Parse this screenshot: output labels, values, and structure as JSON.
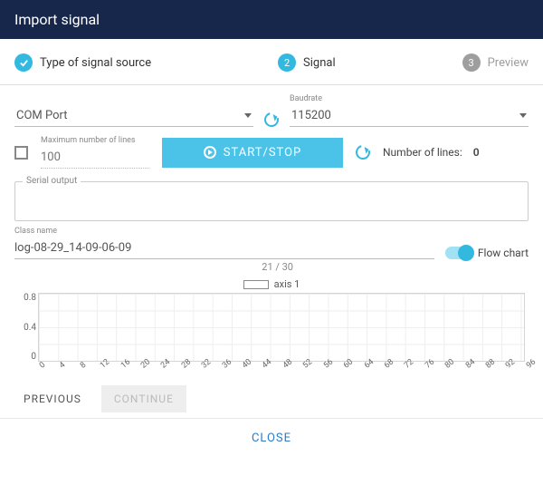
{
  "header": {
    "title": "Import signal"
  },
  "steps": {
    "s1": {
      "label": "Type of signal source"
    },
    "s2": {
      "num": "2",
      "label": "Signal"
    },
    "s3": {
      "num": "3",
      "label": "Preview"
    }
  },
  "fields": {
    "comport": {
      "label": "COM Port",
      "value": ""
    },
    "baudrate": {
      "label": "Baudrate",
      "value": "115200"
    },
    "maxlines": {
      "label": "Maximum number of lines",
      "placeholder": "100"
    },
    "serial_output": {
      "label": "Serial output"
    },
    "classname": {
      "label": "Class name",
      "value": "log-08-29_14-09-06-09",
      "counter": "21 / 30"
    }
  },
  "buttons": {
    "start_stop": "START/STOP",
    "previous": "PREVIOUS",
    "continue": "CONTINUE",
    "close": "CLOSE"
  },
  "labels": {
    "num_lines": "Number of lines:",
    "num_lines_val": "0",
    "flow_chart": "Flow chart"
  },
  "chart_data": {
    "type": "line",
    "series": [
      {
        "name": "axis 1",
        "values": []
      }
    ],
    "x_ticks": [
      "0",
      "4",
      "8",
      "12",
      "16",
      "20",
      "24",
      "28",
      "32",
      "36",
      "40",
      "44",
      "48",
      "52",
      "56",
      "60",
      "64",
      "68",
      "72",
      "76",
      "80",
      "84",
      "88",
      "92",
      "96"
    ],
    "y_ticks": [
      "0.8",
      "0.4",
      "0"
    ],
    "xlim": [
      0,
      96
    ],
    "ylim": [
      0,
      1
    ],
    "legend": "axis 1"
  }
}
